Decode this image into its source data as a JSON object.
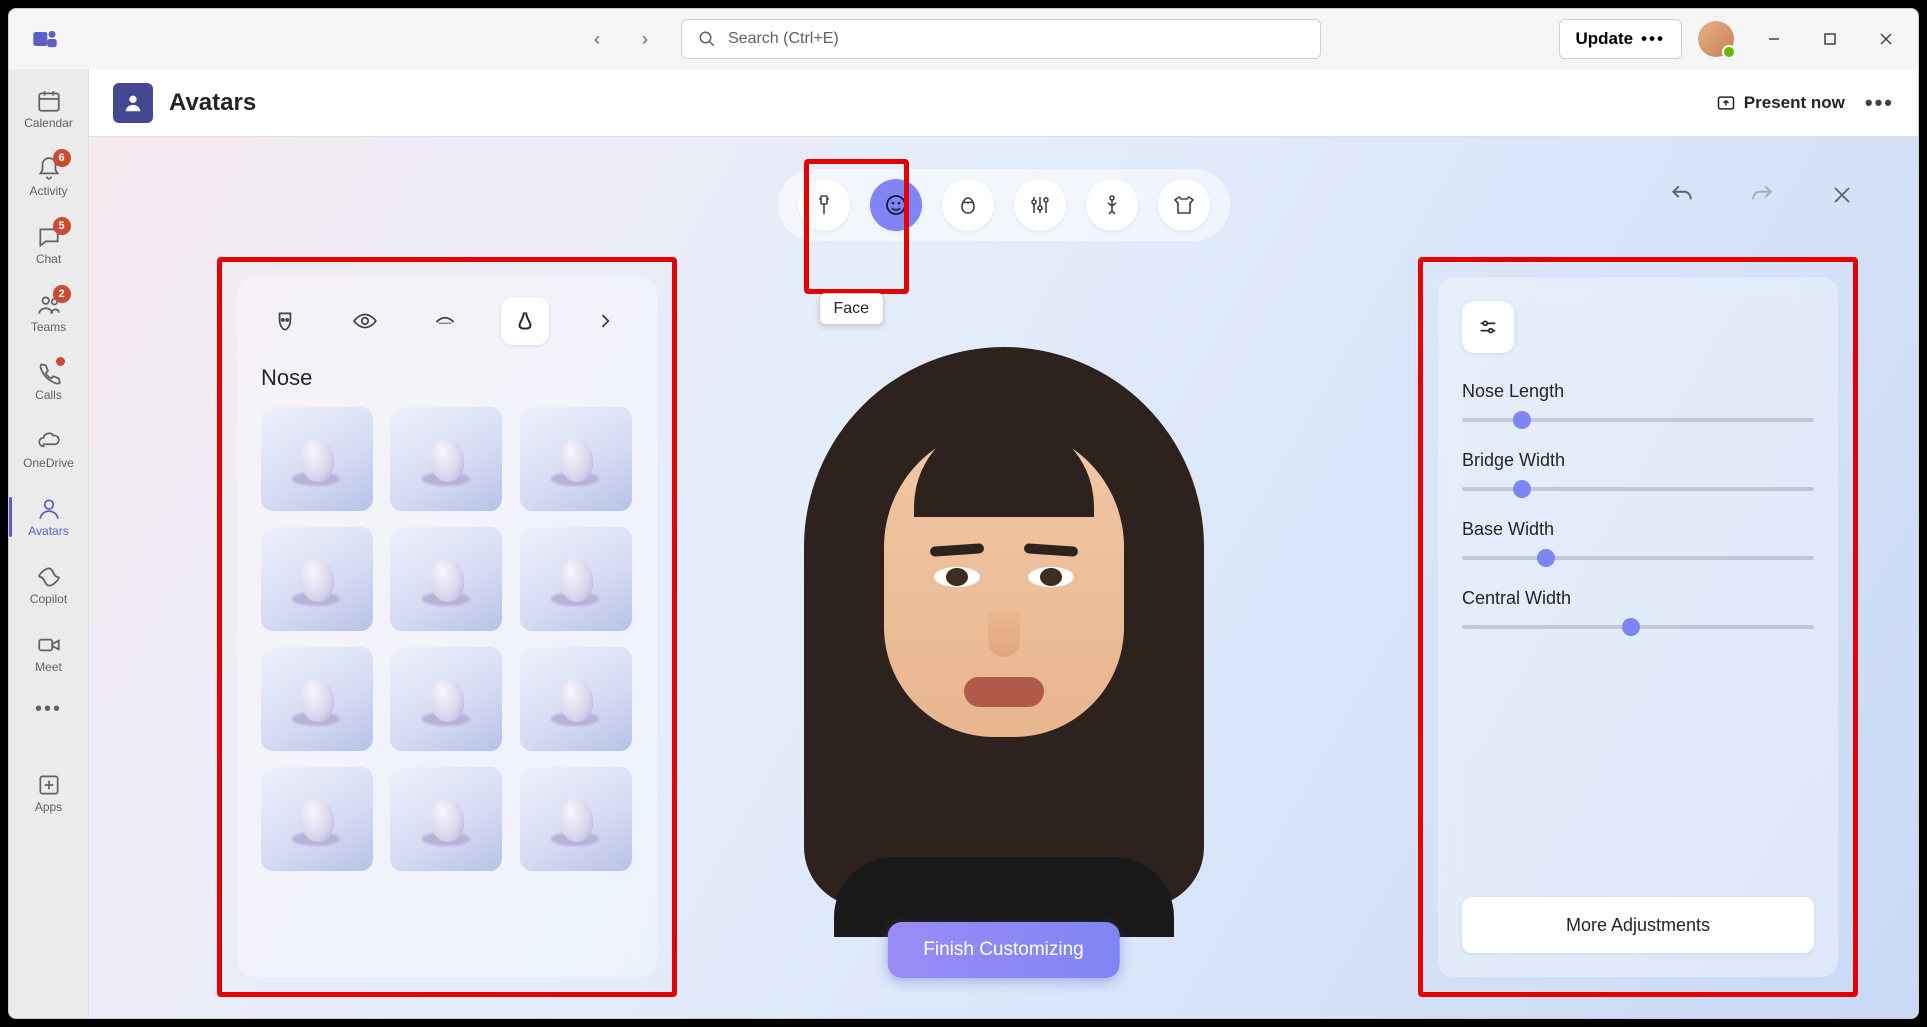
{
  "titlebar": {
    "search_placeholder": "Search (Ctrl+E)",
    "update_label": "Update"
  },
  "siderail": {
    "items": [
      {
        "label": "Calendar",
        "icon": "calendar",
        "badge": null,
        "dot": false,
        "active": false
      },
      {
        "label": "Activity",
        "icon": "bell",
        "badge": "6",
        "dot": false,
        "active": false
      },
      {
        "label": "Chat",
        "icon": "chat",
        "badge": "5",
        "dot": false,
        "active": false
      },
      {
        "label": "Teams",
        "icon": "teams",
        "badge": "2",
        "dot": false,
        "active": false
      },
      {
        "label": "Calls",
        "icon": "phone",
        "badge": null,
        "dot": true,
        "active": false
      },
      {
        "label": "OneDrive",
        "icon": "cloud",
        "badge": null,
        "dot": false,
        "active": false
      },
      {
        "label": "Avatars",
        "icon": "avatar",
        "badge": null,
        "dot": false,
        "active": true
      },
      {
        "label": "Copilot",
        "icon": "copilot",
        "badge": null,
        "dot": false,
        "active": false
      },
      {
        "label": "Meet",
        "icon": "meet",
        "badge": null,
        "dot": false,
        "active": false
      }
    ],
    "apps_label": "Apps"
  },
  "header": {
    "title": "Avatars",
    "present_label": "Present now"
  },
  "top_toolbar": {
    "items": [
      {
        "name": "body-icon"
      },
      {
        "name": "face-icon"
      },
      {
        "name": "hair-icon"
      },
      {
        "name": "appearance-icon"
      },
      {
        "name": "figure-icon"
      },
      {
        "name": "wardrobe-icon"
      }
    ],
    "active_index": 1,
    "tooltip": "Face"
  },
  "left_panel": {
    "tabs": [
      {
        "name": "face-shape-tab"
      },
      {
        "name": "eyes-tab"
      },
      {
        "name": "eyebrows-tab"
      },
      {
        "name": "nose-tab"
      },
      {
        "name": "more-tab"
      }
    ],
    "active_tab_index": 3,
    "title": "Nose",
    "thumb_count": 12
  },
  "right_panel": {
    "sliders": [
      {
        "label": "Nose Length",
        "value_pct": 17
      },
      {
        "label": "Bridge Width",
        "value_pct": 17
      },
      {
        "label": "Base Width",
        "value_pct": 24
      },
      {
        "label": "Central Width",
        "value_pct": 48
      }
    ],
    "more_label": "More Adjustments"
  },
  "finish_label": "Finish Customizing"
}
